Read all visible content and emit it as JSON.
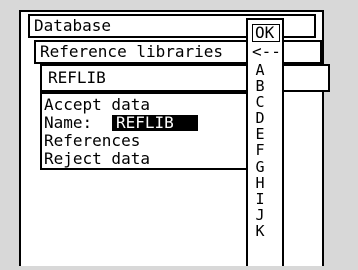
{
  "menu": {
    "title": "Database",
    "submenu": "Reference libraries",
    "current_library": "REFLIB"
  },
  "dialog": {
    "items": [
      {
        "label": "Accept data"
      },
      {
        "label": "Name: ",
        "value": "REFLIB"
      },
      {
        "label": "References"
      },
      {
        "label": "Reject data"
      }
    ]
  },
  "picker": {
    "ok_label": "OK",
    "back_label": "<--",
    "letters": [
      "A",
      "B",
      "C",
      "D",
      "E",
      "F",
      "G",
      "H",
      "I",
      "J",
      "K"
    ]
  }
}
